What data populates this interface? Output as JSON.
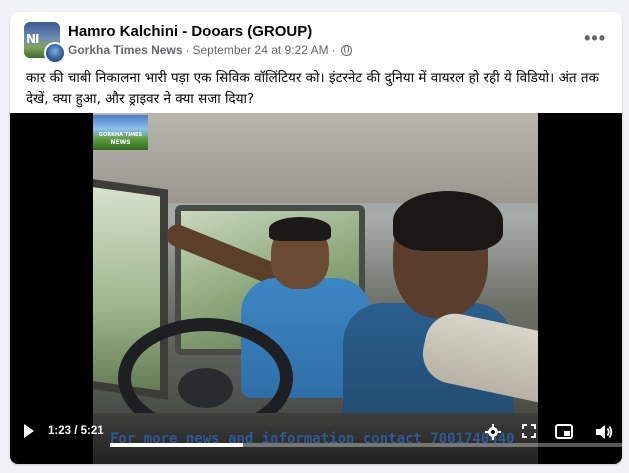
{
  "post": {
    "author": "Hamro Kalchini - Dooars (GROUP)",
    "page_name": "Gorkha Times News",
    "separator": "·",
    "date": "September 24 at 9:22 AM",
    "separator2": "·",
    "more_label": "•••",
    "caption": "कार की चाबी निकालना भारी पड़ा एक सिविक वॉलिंटियर को। इंटरनेट की दुनिया में वायरल हो रही ये विडियो। अंत तक देखें, क्या हुआ, और ड्राइवर ने क्या सजा दिया?"
  },
  "avatar": {
    "main_letters": "NI"
  },
  "video": {
    "logo_line1": "GORKHA TIMES",
    "logo_line2": "NEWS",
    "ticker": "For more news and information contact 7001740440",
    "current_time": "1:23",
    "time_separator": " / ",
    "duration": "5:21",
    "progress_fraction": 0.259
  },
  "colors": {
    "accent": "#1877f2",
    "ticker": "#2f5fa8",
    "meta_text": "#65676b"
  },
  "icons": {
    "play": "play-icon",
    "settings": "gear-icon",
    "expand": "expand-icon",
    "pip": "picture-in-picture-icon",
    "volume": "volume-icon",
    "privacy": "globe-icon"
  }
}
